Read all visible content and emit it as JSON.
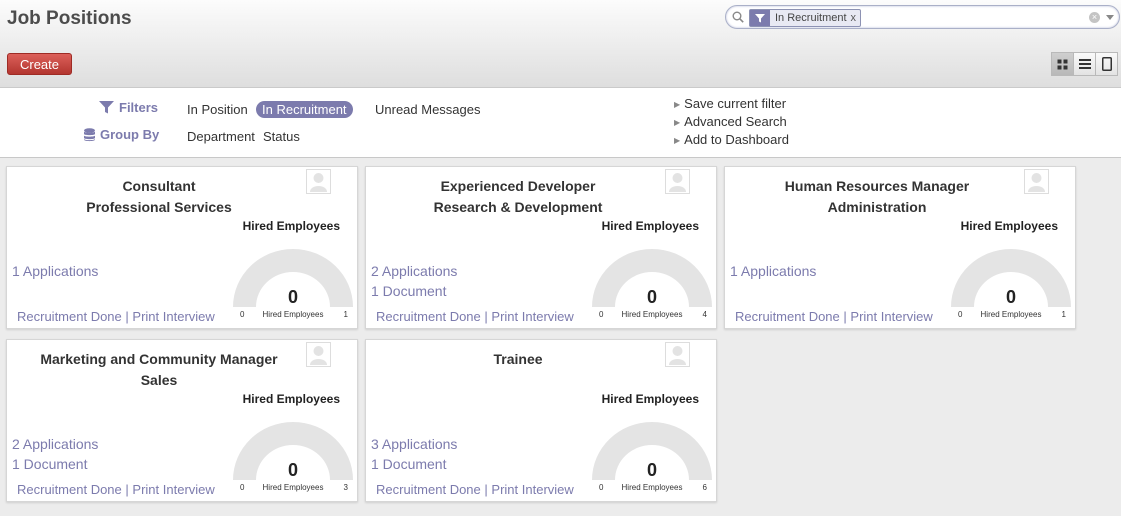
{
  "header": {
    "title": "Job Positions",
    "create_label": "Create"
  },
  "search": {
    "facet_value": "In Recruitment",
    "facet_remove": "x",
    "value": ""
  },
  "drawer": {
    "filters_label": "Filters",
    "filters": [
      "In Position",
      "In Recruitment",
      "Unread Messages"
    ],
    "groupby_label": "Group By",
    "groupby": [
      "Department",
      "Status"
    ],
    "links": [
      "Save current filter",
      "Advanced Search",
      "Add to Dashboard"
    ]
  },
  "cards": [
    {
      "title1": "Consultant",
      "title2": "Professional Services",
      "applications": "1 Applications",
      "documents": "",
      "gauge_title": "Hired Employees",
      "gauge_value": "0",
      "gauge_min": "0",
      "gauge_max": "1",
      "gauge_label": "Hired Employees",
      "recruitment_done": "Recruitment Done",
      "sep": "|",
      "print_interview": "Print Interview"
    },
    {
      "title1": "Experienced Developer",
      "title2": "Research & Development",
      "applications": "2 Applications",
      "documents": "1 Document",
      "gauge_title": "Hired Employees",
      "gauge_value": "0",
      "gauge_min": "0",
      "gauge_max": "4",
      "gauge_label": "Hired Employees",
      "recruitment_done": "Recruitment Done",
      "sep": "|",
      "print_interview": "Print Interview"
    },
    {
      "title1": "Human Resources Manager",
      "title2": "Administration",
      "applications": "1 Applications",
      "documents": "",
      "gauge_title": "Hired Employees",
      "gauge_value": "0",
      "gauge_min": "0",
      "gauge_max": "1",
      "gauge_label": "Hired Employees",
      "recruitment_done": "Recruitment Done",
      "sep": "|",
      "print_interview": "Print Interview"
    },
    {
      "title1": "Marketing and Community Manager",
      "title2": "Sales",
      "applications": "2 Applications",
      "documents": "1 Document",
      "gauge_title": "Hired Employees",
      "gauge_value": "0",
      "gauge_min": "0",
      "gauge_max": "3",
      "gauge_label": "Hired Employees",
      "recruitment_done": "Recruitment Done",
      "sep": "|",
      "print_interview": "Print Interview"
    },
    {
      "title1": "Trainee",
      "title2": "",
      "applications": "3 Applications",
      "documents": "1 Document",
      "gauge_title": "Hired Employees",
      "gauge_value": "0",
      "gauge_min": "0",
      "gauge_max": "6",
      "gauge_label": "Hired Employees",
      "recruitment_done": "Recruitment Done",
      "sep": "|",
      "print_interview": "Print Interview"
    }
  ],
  "icons": {
    "search": "search-icon",
    "filter": "filter-icon",
    "groupby": "database-icon",
    "kanban": "kanban-view-icon",
    "list": "list-view-icon",
    "form": "form-view-icon",
    "avatar": "user-avatar-icon"
  },
  "colors": {
    "accent": "#7c7bad",
    "create": "#c9413b",
    "gauge_track": "#e4e4e4"
  }
}
